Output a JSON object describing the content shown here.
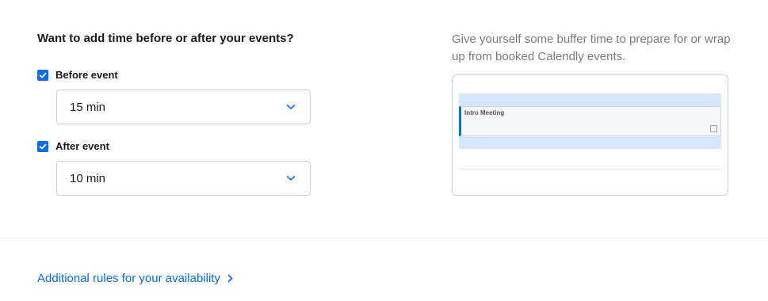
{
  "buffer": {
    "question": "Want to add time before or after your events?",
    "before": {
      "checkbox_label": "Before event",
      "checked": true,
      "selected_value": "15 min"
    },
    "after": {
      "checkbox_label": "After event",
      "checked": true,
      "selected_value": "10 min"
    }
  },
  "helper": {
    "text": "Give yourself some buffer time to prepare for or wrap up from booked Calendly events."
  },
  "preview": {
    "event_title": "Intro Meeting"
  },
  "footer": {
    "link_label": "Additional rules for your availability"
  },
  "icons": {
    "checkbox": "checkmark-icon",
    "select": "chevron-down-icon",
    "link": "chevron-right-icon",
    "event": "calendar-icon"
  },
  "colors": {
    "accent": "#006bff",
    "buffer_band": "#d3e6fb",
    "helper_text": "#7a7a7a",
    "border": "#c9cdd3"
  }
}
